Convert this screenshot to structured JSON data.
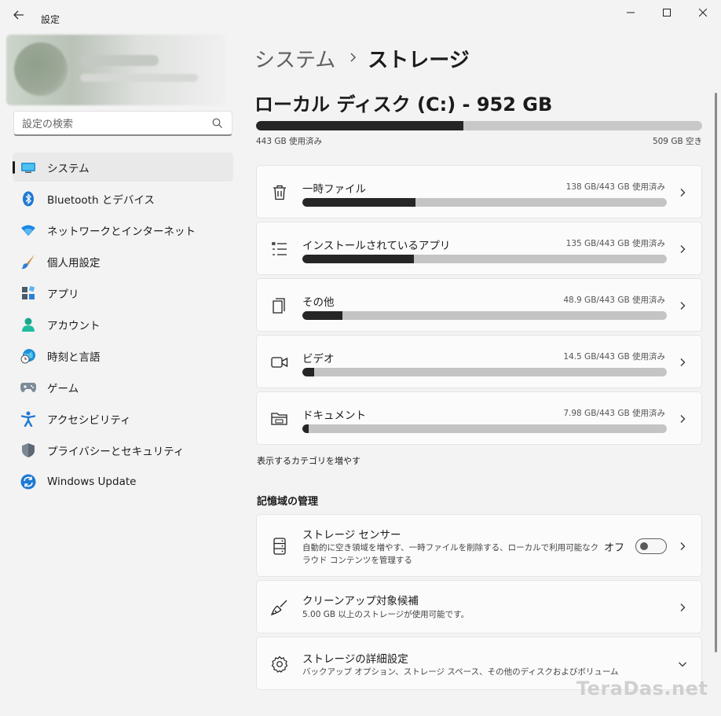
{
  "window": {
    "title": "設定"
  },
  "search": {
    "placeholder": "設定の検索"
  },
  "sidebar": {
    "items": [
      {
        "label": "システム",
        "icon": "system-icon",
        "selected": true
      },
      {
        "label": "Bluetooth とデバイス",
        "icon": "bluetooth-icon"
      },
      {
        "label": "ネットワークとインターネット",
        "icon": "wifi-icon"
      },
      {
        "label": "個人用設定",
        "icon": "paintbrush-icon"
      },
      {
        "label": "アプリ",
        "icon": "apps-icon"
      },
      {
        "label": "アカウント",
        "icon": "account-icon"
      },
      {
        "label": "時刻と言語",
        "icon": "globe-clock-icon"
      },
      {
        "label": "ゲーム",
        "icon": "gamepad-icon"
      },
      {
        "label": "アクセシビリティ",
        "icon": "accessibility-icon"
      },
      {
        "label": "プライバシーとセキュリティ",
        "icon": "shield-icon"
      },
      {
        "label": "Windows Update",
        "icon": "update-icon"
      }
    ]
  },
  "breadcrumb": {
    "parent": "システム",
    "current": "ストレージ"
  },
  "disk": {
    "title": "ローカル ディスク (C:) - 952 GB",
    "used_label": "443 GB 使用済み",
    "free_label": "509 GB 空き",
    "used_fraction": 0.465
  },
  "categories": [
    {
      "label": "一時ファイル",
      "usage": "138 GB/443 GB 使用済み",
      "fraction": 0.311,
      "icon": "trash-icon"
    },
    {
      "label": "インストールされているアプリ",
      "usage": "135 GB/443 GB 使用済み",
      "fraction": 0.305,
      "icon": "list-icon"
    },
    {
      "label": "その他",
      "usage": "48.9 GB/443 GB 使用済み",
      "fraction": 0.11,
      "icon": "document-other-icon"
    },
    {
      "label": "ビデオ",
      "usage": "14.5 GB/443 GB 使用済み",
      "fraction": 0.033,
      "icon": "video-icon"
    },
    {
      "label": "ドキュメント",
      "usage": "7.98 GB/443 GB 使用済み",
      "fraction": 0.018,
      "icon": "folder-icon"
    }
  ],
  "more_categories": "表示するカテゴリを増やす",
  "management": {
    "title": "記憶域の管理",
    "sense": {
      "label": "ストレージ センサー",
      "desc1": "自動的に空き領域を増やす、一時ファイルを削除する、ローカルで利用可能なク",
      "desc2": "ラウド コンテンツを管理する",
      "toggle_label": "オフ",
      "toggle_on": false,
      "icon": "storage-drive-icon"
    },
    "cleanup": {
      "label": "クリーンアップ対象候補",
      "desc": "5.00 GB 以上のストレージが使用可能です。",
      "icon": "broom-icon"
    },
    "advanced": {
      "label": "ストレージの詳細設定",
      "desc": "バックアップ オプション、ストレージ スペース、その他のディスクおよびボリューム",
      "icon": "gear-icon"
    }
  },
  "watermark": "TeraDas.net"
}
